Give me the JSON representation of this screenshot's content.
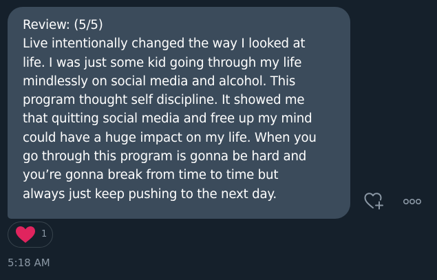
{
  "message": {
    "lines": [
      "Review: (5/5)",
      "Live intentionally changed the way I looked at",
      "life. I was just some kid going through my life",
      "mindlessly on social media and alcohol. This",
      "program thought self discipline. It showed me",
      "that quitting social media and free up my mind",
      "could have a huge impact on my life. When you",
      "go through this program is gonna be hard and",
      "you’re gonna break from time to time but",
      "always just keep pushing to the next day."
    ],
    "timestamp": "5:18 AM"
  },
  "reaction": {
    "emoji": "heart-icon",
    "count": "1"
  },
  "actions": {
    "add_reaction_icon": "heart-plus-icon",
    "more_icon": "more-horizontal-icon"
  },
  "colors": {
    "background": "#15202b",
    "bubble": "#3b4b5b",
    "text": "#ffffff",
    "secondary_text": "#8b98a5",
    "heart": "#e0245e"
  }
}
